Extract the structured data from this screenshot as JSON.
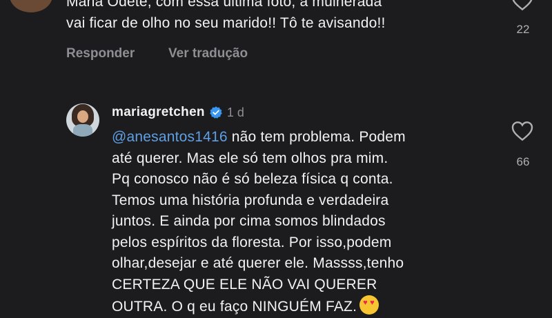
{
  "comment1": {
    "text": "Maria Odete, com essa última foto, a mulherada\nvai ficar de olho no seu marido!! Tô te avisando!!",
    "like_count": "22",
    "reply_label": "Responder",
    "translate_label": "Ver tradução"
  },
  "comment2": {
    "username": "mariagretchen",
    "time": "1 d",
    "mention": "@anesantos1416",
    "text_after_mention": " não tem problema. Podem\naté querer. Mas ele só tem olhos pra mim.\nPq conosco não é só beleza física q conta.\nTemos uma história profunda e verdadeira\njuntos. E ainda por cima somos blindados\npelos espíritos da floresta. Por isso,podem\nolhar,desejar e até querer ele. Massss,tenho\nCERTEZA QUE ELE NÃO VAI QUERER\nOUTRA. O q eu faço NINGUÉM FAZ.",
    "emoji": "heart-eyes-emoji",
    "like_count": "66"
  },
  "icons": {
    "heart": "heart-icon",
    "verified": "verified-badge-icon"
  },
  "colors": {
    "background": "#1c1c1e",
    "mention": "#5ea0e6",
    "verified": "#3897f0",
    "secondary_text": "#8e8e93"
  }
}
